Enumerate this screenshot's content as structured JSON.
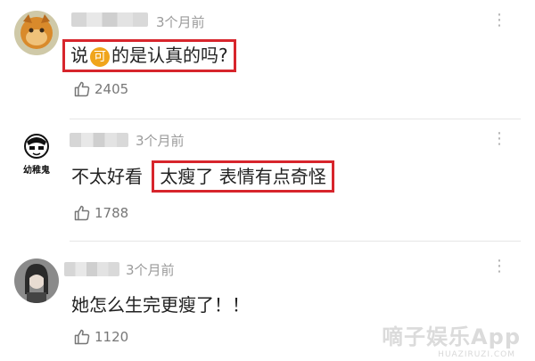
{
  "comments": [
    {
      "time": "3个月前",
      "text_before": "说",
      "emoji_char": "可",
      "text_after": "的是认真的吗?",
      "likes": "2405",
      "highlight_color": "#d7252c"
    },
    {
      "time": "3个月前",
      "avatar_label": "幼稚鬼",
      "text_plain": "不太好看",
      "text_highlighted": "太瘦了 表情有点奇怪",
      "likes": "1788"
    },
    {
      "time": "3个月前",
      "text": "她怎么生完更瘦了！！",
      "likes": "1120"
    }
  ],
  "watermark": {
    "text": "嘀子娱乐App",
    "sub": "HUAZIRUZI.COM"
  },
  "icons": {
    "like": "thumbs-up-icon",
    "more": "more-dots-icon"
  }
}
